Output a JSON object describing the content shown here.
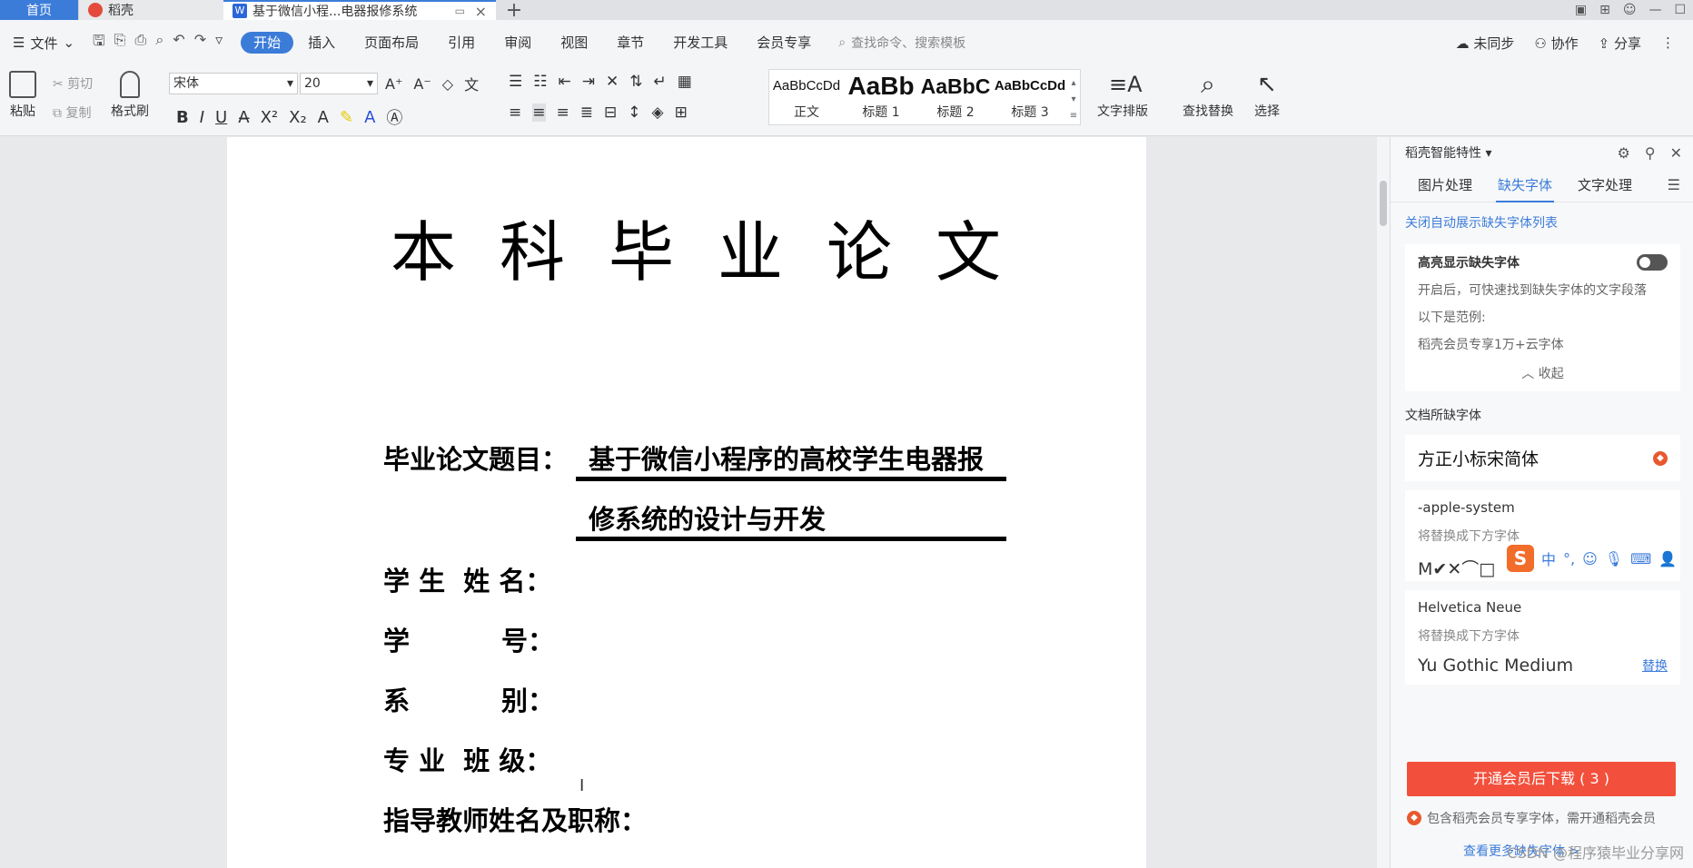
{
  "tabs": {
    "home": "首页",
    "daoke": "稻壳",
    "doc": "基于微信小程...电器报修系统"
  },
  "menu": {
    "file": "文件",
    "items": [
      "开始",
      "插入",
      "页面布局",
      "引用",
      "审阅",
      "视图",
      "章节",
      "开发工具",
      "会员专享"
    ],
    "search_placeholder": "查找命令、搜索模板",
    "unsync": "未同步",
    "collab": "协作",
    "share": "分享"
  },
  "ribbon": {
    "paste": "粘贴",
    "cut": "剪切",
    "copy": "复制",
    "format_painter": "格式刷",
    "font_name": "宋体",
    "font_size": "20",
    "styles": [
      {
        "preview": "AaBbCcDd",
        "label": "正文"
      },
      {
        "preview": "AaBb",
        "label": "标题 1"
      },
      {
        "preview": "AaBbC",
        "label": "标题 2"
      },
      {
        "preview": "AaBbCcDd",
        "label": "标题 3"
      }
    ],
    "text_layout": "文字排版",
    "find_replace": "查找替换",
    "select": "选择"
  },
  "document": {
    "title": "本科毕业论文",
    "thesis_label": "毕业论文题目：",
    "thesis_line1": "基于微信小程序的高校学生电器报",
    "thesis_line2": "修系统的设计与开发",
    "student_name": "学 生  姓 名：",
    "student_id": "学          号：",
    "department": "系          别：",
    "major_class": "专 业  班 级：",
    "advisor": "指导教师姓名及职称："
  },
  "panel": {
    "header": "稻壳智能特性",
    "tabs": [
      "图片处理",
      "缺失字体",
      "文字处理"
    ],
    "active_tab": 1,
    "auto_link": "关闭自动展示缺失字体列表",
    "highlight_title": "高亮显示缺失字体",
    "highlight_desc": "开启后，可快速找到缺失字体的文字段落",
    "example_label": "以下是范例:",
    "example_value": "稻壳会员专享1万+云字体",
    "collapse": "收起",
    "missing_title": "文档所缺字体",
    "missing_font_1": "方正小标宋简体",
    "font_2_name": "-apple-system",
    "font_2_sub": "将替换成下方字体",
    "font_2_replace": "M✔✕⌒□",
    "font_3_name": "Helvetica Neue",
    "font_3_sub": "将替换成下方字体",
    "font_3_replace": "Yu Gothic Medium",
    "replace_link": "替换",
    "download_btn": "开通会员后下载 ( 3 )",
    "vip_note": "包含稻壳会员专享字体，需开通稻壳会员",
    "more_link": "查看更多缺失字体 >"
  },
  "ime": {
    "logo": "S",
    "lang": "中"
  },
  "watermark": "CSDN @程序猿毕业分享网",
  "colors": {
    "accent": "#3c7cd9",
    "download": "#f2503c"
  }
}
